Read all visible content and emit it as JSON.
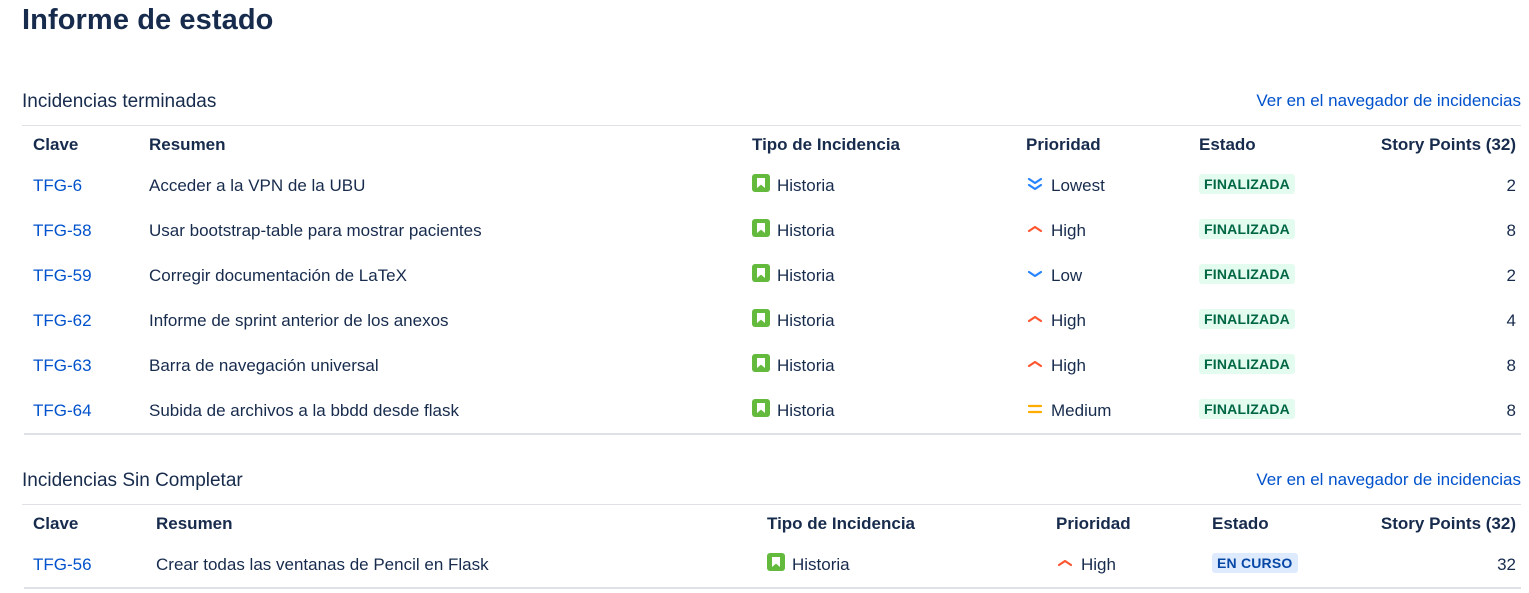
{
  "page": {
    "title": "Informe de estado"
  },
  "columns": {
    "key": "Clave",
    "summary": "Resumen",
    "type": "Tipo de Incidencia",
    "priority": "Prioridad",
    "status": "Estado",
    "points": "Story Points (32)"
  },
  "completed": {
    "title": "Incidencias terminadas",
    "link": "Ver en el navegador de incidencias",
    "rows": [
      {
        "key": "TFG-6",
        "summary": "Acceder a la VPN de la UBU",
        "type": "Historia",
        "priority": "Lowest",
        "priority_icon": "lowest",
        "status": "FINALIZADA",
        "points": "2"
      },
      {
        "key": "TFG-58",
        "summary": "Usar bootstrap-table para mostrar pacientes",
        "type": "Historia",
        "priority": "High",
        "priority_icon": "high",
        "status": "FINALIZADA",
        "points": "8"
      },
      {
        "key": "TFG-59",
        "summary": "Corregir documentación de LaTeX",
        "type": "Historia",
        "priority": "Low",
        "priority_icon": "low",
        "status": "FINALIZADA",
        "points": "2"
      },
      {
        "key": "TFG-62",
        "summary": "Informe de sprint anterior de los anexos",
        "type": "Historia",
        "priority": "High",
        "priority_icon": "high",
        "status": "FINALIZADA",
        "points": "4"
      },
      {
        "key": "TFG-63",
        "summary": "Barra de navegación universal",
        "type": "Historia",
        "priority": "High",
        "priority_icon": "high",
        "status": "FINALIZADA",
        "points": "8"
      },
      {
        "key": "TFG-64",
        "summary": "Subida de archivos a la bbdd desde flask",
        "type": "Historia",
        "priority": "Medium",
        "priority_icon": "medium",
        "status": "FINALIZADA",
        "points": "8"
      }
    ]
  },
  "incomplete": {
    "title": "Incidencias Sin Completar",
    "link": "Ver en el navegador de incidencias",
    "rows": [
      {
        "key": "TFG-56",
        "summary": "Crear todas las ventanas de Pencil en Flask",
        "type": "Historia",
        "priority": "High",
        "priority_icon": "high",
        "status": "EN CURSO",
        "points": "32"
      }
    ]
  },
  "colors": {
    "link": "#0052cc",
    "story": "#63ba3c",
    "high": "#ff5630",
    "medium": "#ffab00",
    "low": "#2684ff",
    "done_bg": "#e3fcef",
    "done_fg": "#006644",
    "progress_bg": "#deebff",
    "progress_fg": "#0747a6"
  }
}
